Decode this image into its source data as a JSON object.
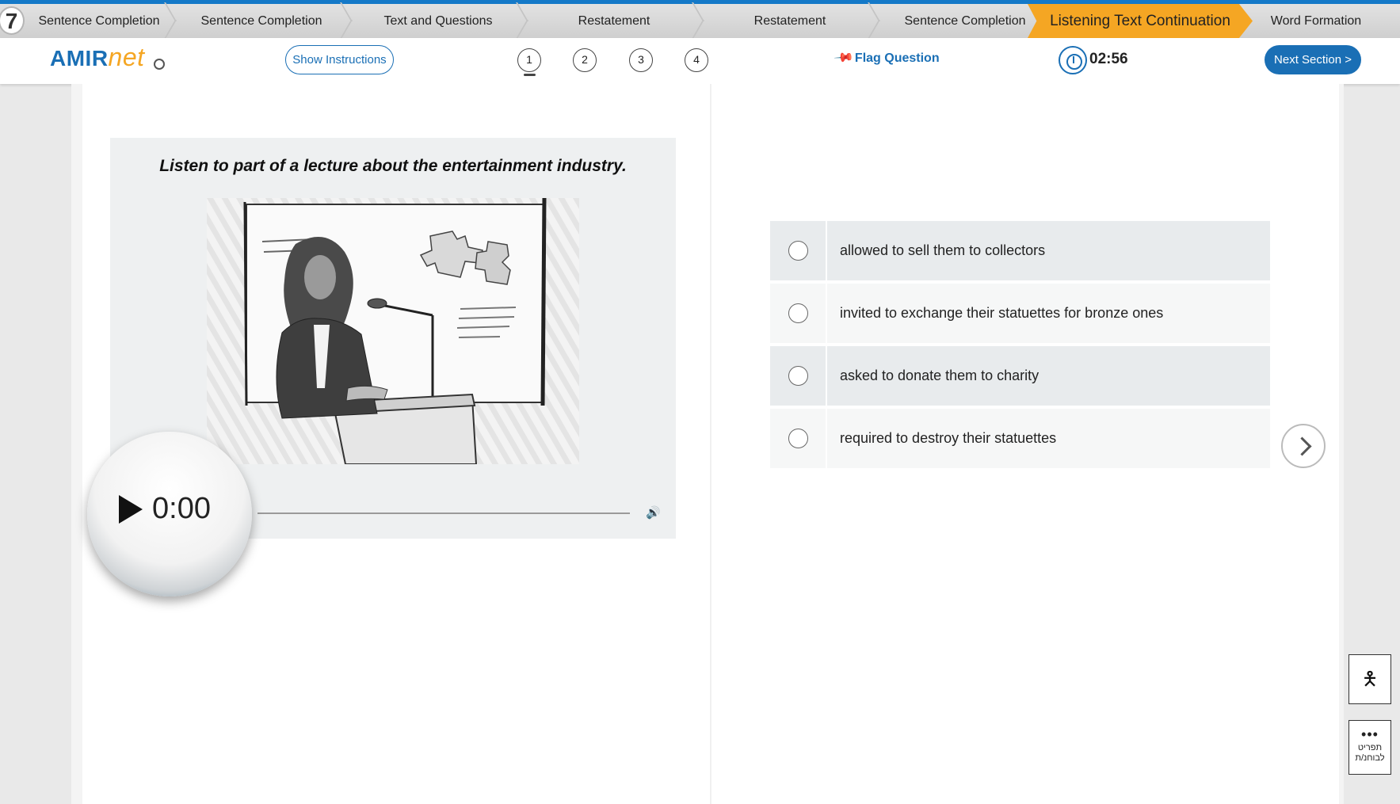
{
  "step_bar": {
    "current_number": "7",
    "steps": [
      "Sentence Completion",
      "Sentence Completion",
      "Text and Questions",
      "Restatement",
      "Restatement",
      "Sentence Completion"
    ],
    "active_step": "Listening Text Continuation",
    "next_step": "Word Formation"
  },
  "header": {
    "logo_main": "AMIR",
    "logo_accent": "net",
    "show_instructions": "Show Instructions",
    "questions": [
      "1",
      "2",
      "3",
      "4"
    ],
    "current_question": "1",
    "flag_question": "Flag Question",
    "timer": "02:56",
    "next_section": "Next Section >"
  },
  "media": {
    "prompt": "Listen to part of a lecture about the entertainment industry.",
    "audio_time": "0:00",
    "audio_progress": 0
  },
  "options": [
    {
      "text": "allowed to sell them to collectors",
      "selected": false
    },
    {
      "text": "invited to exchange their statuettes for bronze ones",
      "selected": false
    },
    {
      "text": "asked to donate them to charity",
      "selected": false
    },
    {
      "text": "required to destroy their statuettes",
      "selected": false
    }
  ],
  "side_tools": {
    "print_label": "תפריט לבוחנ/ת"
  },
  "colors": {
    "brand_blue": "#1a6fb5",
    "active_step": "#f5a623",
    "option_shaded": "#e8ebed"
  }
}
